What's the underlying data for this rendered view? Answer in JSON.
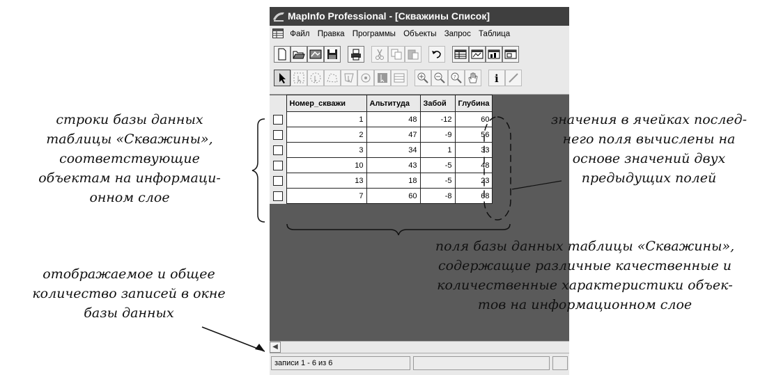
{
  "window": {
    "title": "MapInfo Professional - [Скважины Список]",
    "menu": [
      "Файл",
      "Правка",
      "Программы",
      "Объекты",
      "Запрос",
      "Таблица"
    ]
  },
  "toolbar1_icons": [
    "new-file-icon",
    "open-icon",
    "open-workspace-icon",
    "save-icon",
    "print-icon",
    "cut-icon",
    "copy-icon",
    "paste-icon",
    "undo-icon",
    "new-browser-icon",
    "new-mapper-icon",
    "new-grapher-icon",
    "new-layout-icon"
  ],
  "toolbar2_icons": [
    "select-arrow-icon",
    "marquee-select-icon",
    "radius-select-icon",
    "polygon-select-icon",
    "boundary-select-icon",
    "graph-select-icon",
    "invert-select-icon",
    "unselect-icon",
    "zoom-in-icon",
    "zoom-out-icon",
    "change-view-icon",
    "grabber-icon",
    "info-icon",
    "ruler-icon"
  ],
  "table": {
    "columns": [
      "Номер_скважи",
      "Альтитуда",
      "Забой",
      "Глубина"
    ],
    "rows": [
      [
        "1",
        "48",
        "-12",
        "60"
      ],
      [
        "2",
        "47",
        "-9",
        "56"
      ],
      [
        "3",
        "34",
        "1",
        "33"
      ],
      [
        "10",
        "43",
        "-5",
        "48"
      ],
      [
        "13",
        "18",
        "-5",
        "23"
      ],
      [
        "7",
        "60",
        "-8",
        "68"
      ]
    ]
  },
  "status": {
    "records": "записи 1 - 6 из 6"
  },
  "annotations": {
    "rows": [
      "строки базы данных",
      "таблицы «Скважины»,",
      "соответствующие",
      "объектам на информаци-",
      "онном слое"
    ],
    "last_field": [
      "значения в ячейках послед-",
      "него поля вычислены на",
      "основе значений двух",
      "предыдущих полей"
    ],
    "fields": [
      "поля базы данных таблицы «Скважины»,",
      "содержащие различные качественные и",
      "количественные характеристики объек-",
      "тов на информационном слое"
    ],
    "count": [
      "отображаемое и общее",
      "количество записей в окне",
      "базы данных"
    ]
  }
}
